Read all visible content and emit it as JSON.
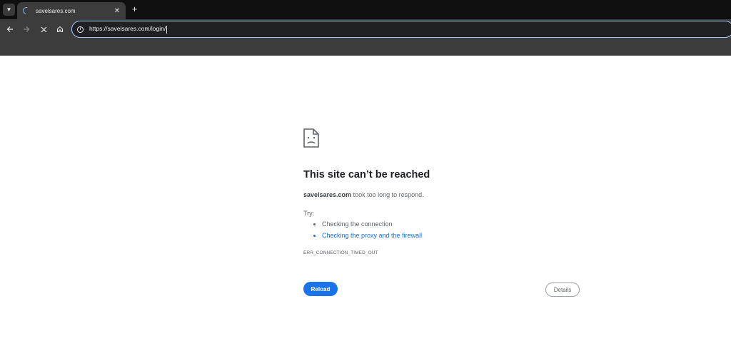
{
  "browser": {
    "tab_menu_icon": "chevron-down-icon",
    "tab": {
      "title": "savelsares.com",
      "loading_icon": "spinner-icon",
      "close_label": "✕"
    },
    "new_tab_label": "+",
    "nav": {
      "back_icon": "back-arrow-icon",
      "forward_icon": "forward-arrow-icon",
      "stop_icon": "stop-icon",
      "home_icon": "home-icon"
    },
    "omnibox": {
      "url": "https://savelsares.com/login/",
      "site_info_icon": "info-icon"
    }
  },
  "error_page": {
    "icon": "sad-page-icon",
    "title": "This site can’t be reached",
    "summary_host": "savelsares.com",
    "summary_rest": " took too long to respond.",
    "try_label": "Try:",
    "suggestions": [
      {
        "text": "Checking the connection",
        "link": false
      },
      {
        "text": "Checking the proxy and the firewall",
        "link": true
      }
    ],
    "error_code": "ERR_CONNECTION_TIMED_OUT",
    "reload_label": "Reload",
    "details_label": "Details"
  },
  "colors": {
    "accent": "#1a73e8",
    "chrome_dark": "#0f0f0f",
    "toolbar": "#3c3c3c",
    "omnibox_focus": "#a8c7fa"
  }
}
